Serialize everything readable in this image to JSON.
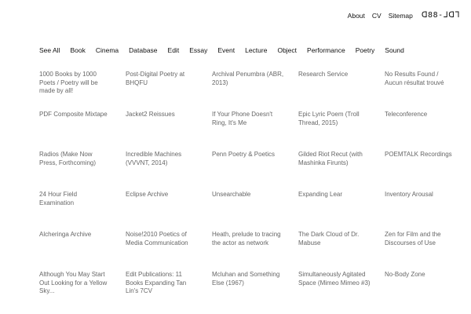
{
  "top_nav": {
    "about": "About",
    "cv": "CV",
    "sitemap": "Sitemap",
    "logo": "ᗡ88-ᒧᗡᒣ"
  },
  "categories": [
    "See All",
    "Book",
    "Cinema",
    "Database",
    "Edit",
    "Essay",
    "Event",
    "Lecture",
    "Object",
    "Performance",
    "Poetry",
    "Sound"
  ],
  "projects": [
    "1000 Books by 1000 Poets / Poetry will be made by all!",
    "Post-Digital Poetry at BHQFU",
    "Archival Penumbra (ABR, 2013)",
    "Research Service",
    "No Results Found / Aucun résultat trouvé",
    "PDF Composite Mixtape",
    "Jacket2 Reissues",
    "If Your Phone Doesn't Ring, It's Me",
    "Epic Lyric Poem (Troll Thread, 2015)",
    "Teleconference",
    "Radios (Make Now Press, Forthcoming)",
    "Incredible Machines (VVVNT, 2014)",
    "Penn Poetry & Poetics",
    "Gilded Riot Recut (with Mashinka Firunts)",
    "POEMTALK Recordings",
    "24 Hour Field Examination",
    "Eclipse Archive",
    "Unsearchable",
    "Expanding Lear",
    "Inventory Arousal",
    "Alcheringa Archive",
    "Noise!2010 Poetics of Media Communication",
    "Heath, prelude to tracing the actor as network",
    "The Dark Cloud of Dr. Mabuse",
    "Zen for Film and the Discourses of Use",
    "Although You May Start Out Looking for a Yellow Sky...",
    "Edit Publications: 11 Books Expanding Tan Lin's 7CV",
    "Mcluhan and Something Else (1967)",
    "Simultaneously Agitated Space (Mimeo Mimeo #3)",
    "No-Body Zone"
  ]
}
